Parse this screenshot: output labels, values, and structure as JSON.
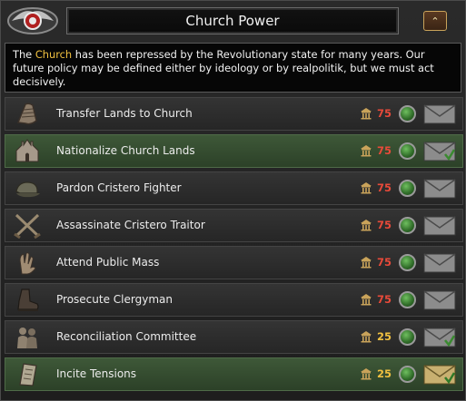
{
  "header": {
    "title": "Church Power",
    "collapse_glyph": "⌃"
  },
  "description": {
    "before": "The ",
    "highlight": "Church",
    "after": " has been repressed by the Revolutionary state for many years. Our future policy may be defined either by ideology or by realpolitik, but we must act decisively."
  },
  "colors": {
    "cost_red": "#e84a3a",
    "cost_yellow": "#f0c040",
    "highlight": "#f0c040"
  },
  "decisions": [
    {
      "label": "Transfer Lands to Church",
      "cost": "75",
      "cost_color": "red",
      "icon": "scroll-icon",
      "style": "gray",
      "envelope": "envelope-icon"
    },
    {
      "label": "Nationalize Church Lands",
      "cost": "75",
      "cost_color": "red",
      "icon": "cathedral-icon",
      "style": "green",
      "envelope": "envelope-check-icon"
    },
    {
      "label": "Pardon Cristero Fighter",
      "cost": "75",
      "cost_color": "red",
      "icon": "cap-icon",
      "style": "gray",
      "envelope": "envelope-icon"
    },
    {
      "label": "Assassinate Cristero Traitor",
      "cost": "75",
      "cost_color": "red",
      "icon": "crossed-rifles-icon",
      "style": "gray",
      "envelope": "envelope-icon"
    },
    {
      "label": "Attend Public Mass",
      "cost": "75",
      "cost_color": "red",
      "icon": "hands-icon",
      "style": "gray",
      "envelope": "envelope-icon"
    },
    {
      "label": "Prosecute Clergyman",
      "cost": "75",
      "cost_color": "red",
      "icon": "boot-icon",
      "style": "gray",
      "envelope": "envelope-icon"
    },
    {
      "label": "Reconciliation Committee",
      "cost": "25",
      "cost_color": "yellow",
      "icon": "people-icon",
      "style": "gray",
      "envelope": "envelope-check-icon"
    },
    {
      "label": "Incite Tensions",
      "cost": "25",
      "cost_color": "yellow",
      "icon": "paper-icon",
      "style": "green",
      "envelope": "envelope-check-gold-icon"
    }
  ]
}
